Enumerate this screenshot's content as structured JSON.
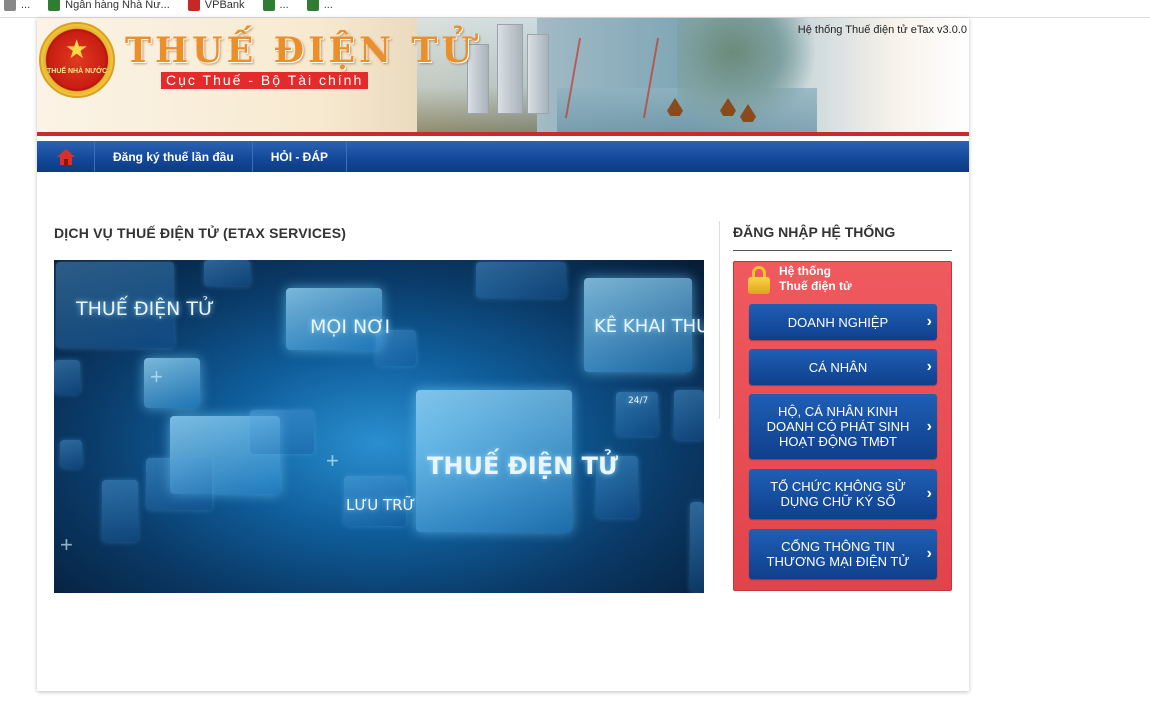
{
  "browser": {
    "bookmarks": [
      {
        "label": "...",
        "color": "#888888"
      },
      {
        "label": "Ngân hàng Nhà Nư...",
        "color": "#2e7d32"
      },
      {
        "label": "VPBank",
        "color": "#c62828"
      },
      {
        "label": "...",
        "color": "#2e7d32"
      },
      {
        "label": "...",
        "color": "#2e7d32"
      }
    ]
  },
  "header": {
    "emblem_text": "THUẾ NHÀ NƯỚC",
    "title": "THUẾ ĐIỆN TỬ",
    "subtitle": "Cục Thuế - Bộ Tài chính",
    "version": "Hệ thống Thuế điện tử eTax v3.0.0"
  },
  "nav": {
    "home_icon": "home-icon",
    "items": [
      {
        "label": "Đăng ký thuế lần đầu"
      },
      {
        "label": "HỎI - ĐÁP"
      }
    ]
  },
  "main": {
    "section_title": "DỊCH VỤ THUẾ ĐIỆN TỬ (ETAX SERVICES)",
    "hero": {
      "texts": [
        "THUẾ ĐIỆN TỬ",
        "MỌI NƠI",
        "KÊ KHAI THUẾ",
        "THUẾ ĐIỆN TỬ",
        "LƯU TRỮ",
        "24/7"
      ]
    }
  },
  "login": {
    "title": "ĐĂNG NHẬP HỆ THỐNG",
    "panel_line1": "Hệ thống",
    "panel_line2": "Thuế điện tử",
    "buttons": [
      {
        "label": "DOANH NGHIỆP"
      },
      {
        "label": "CÁ NHÂN"
      },
      {
        "label": "HỘ, CÁ NHÂN KINH DOANH CÓ PHÁT SINH HOẠT ĐỘNG TMĐT"
      },
      {
        "label": "TỔ CHỨC KHÔNG SỬ DỤNG CHỮ KÝ SỐ"
      },
      {
        "label": "CỔNG THÔNG TIN THƯƠNG MẠI ĐIỆN TỬ"
      }
    ]
  },
  "colors": {
    "nav_blue": "#144a9b",
    "accent_red": "#c82b2b",
    "login_panel": "#e2434b",
    "title_orange": "#e98f2c"
  }
}
